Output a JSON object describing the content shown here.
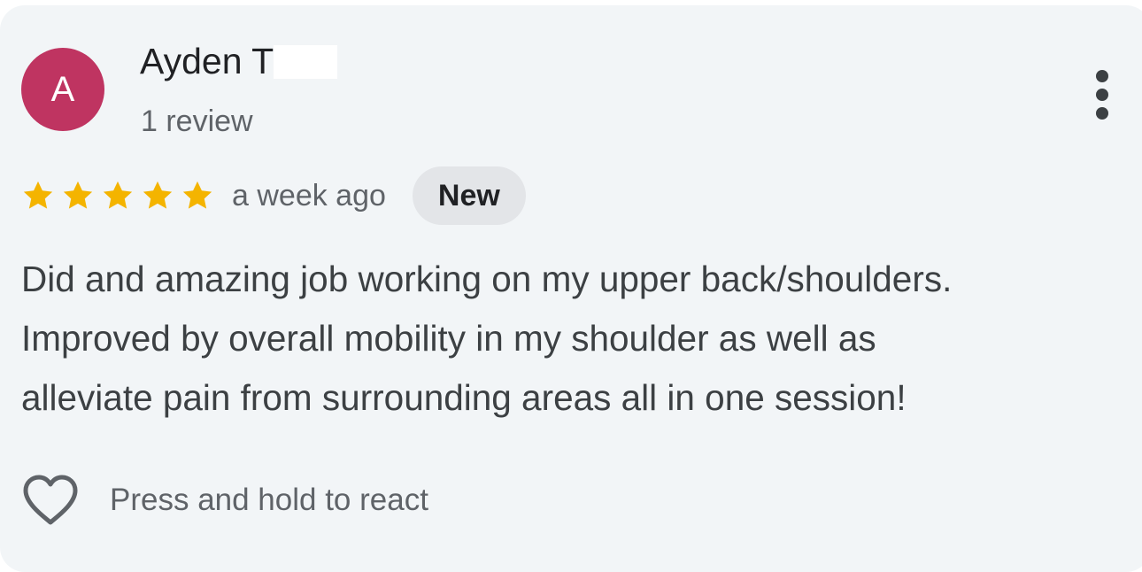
{
  "review": {
    "author": {
      "initial": "A",
      "name": "Ayden T",
      "review_count": "1 review",
      "avatar_color": "#bf3461"
    },
    "more_options_icon": "more-vert-icon",
    "rating": {
      "stars": 5,
      "max_stars": 5,
      "star_color": "#f4b400",
      "date": "a week ago",
      "badge": "New"
    },
    "text_lines": [
      "Did and amazing job working on my upper back/shoulders.",
      "Improved by overall mobility in my shoulder as well as",
      "alleviate pain from surrounding areas all in one session!"
    ],
    "react": {
      "icon": "heart-outline-icon",
      "label": "Press and hold to react"
    }
  }
}
